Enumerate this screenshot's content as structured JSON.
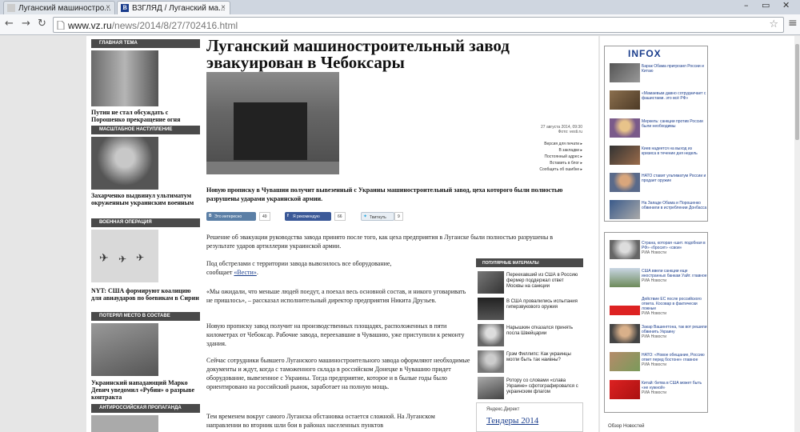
{
  "browser": {
    "tabs": [
      {
        "label": "Луганский машиностро...",
        "active": false
      },
      {
        "label": "ВЗГЛЯД / Луганский ма...",
        "active": true
      }
    ],
    "url_domain": "www.vz.ru",
    "url_path": "/news/2014/8/27/702416.html",
    "icons": [
      "back-icon",
      "forward-icon",
      "reload-icon",
      "star-icon",
      "menu-icon"
    ]
  },
  "sidebar": {
    "sections": [
      {
        "header": "ГЛАВНАЯ ТЕМА",
        "caption": "Путин не стал обсуждать с Порошенко прекращение огня"
      },
      {
        "header": "МАСШТАБНОЕ НАСТУПЛЕНИЕ",
        "caption": "Захарченко выдвинул ультиматум окруженным украинским военным"
      },
      {
        "header": "ВОЕННАЯ ОПЕРАЦИЯ",
        "caption": "NYT: США формируют коалицию для авиаударов по боевикам в Сирии"
      },
      {
        "header": "ПОТЕРЯЛ МЕСТО В СОСТАВЕ",
        "caption": "Украинский нападающий Марко Девич уведомил «Рубин» о разрыве контракта"
      },
      {
        "header": "АНТИРОССИЙСКАЯ ПРОПАГАНДА",
        "caption": ""
      }
    ]
  },
  "article": {
    "title": "Луганский машиностроительный завод эвакуирован в Чебоксары",
    "date": "27 августа 2014, 09:30",
    "source": "Фото: vesti.ru",
    "links": [
      "Версия для печати",
      "В закладки",
      "Постоянный адрес",
      "Вставить в блог",
      "Сообщить об ошибке"
    ],
    "lead": "Новую прописку в Чувашии получит вывезенный с Украины машиностроительный завод, цеха которого были полностью разрушены ударами украинской армии.",
    "share": {
      "vk_label": "Это интересно",
      "vk_count": "49",
      "fb_label": "Я рекомендую",
      "fb_count": "66",
      "tw_label": "Твитнуть",
      "tw_count": "9"
    },
    "p1": "Решение об эвакуации руководства завода принято после того, как цеха предприятия в Луганске были полностью разрушены в результате ударов артиллерии украинской армии.",
    "p2a": "Под обстрелами с территории завода вывозилось все оборудование,",
    "p2b": "сообщает",
    "p2link": "«Вести»",
    "p3": "«Мы ожидали, что меньше людей поедут, а поехал весь основной состав, и никого уговаривать не пришлось», – рассказал исполнительный директор предприятия Никита Друзьев.",
    "p4": "Новую прописку завод получит на производственных площадях, расположенных в пяти километрах от Чебоксар. Рабочие завода, переехавшие в Чувашию, уже приступили к ремонту здания.",
    "p5": "Сейчас сотрудники бывшего Луганского машиностроительного завода оформляют необходимые документы и ждут, когда с таможенного склада в российском Донецке в Чувашию придет оборудование, вывезенное с Украины. Тогда предприятие, которое и в былые годы было ориентировано на российский рынок, заработает на полную мощь.",
    "p6": "Тем временем вокруг самого Луганска обстановка остается сложной. На Луганском направлении во вторник шли бои в районах населенных пунктов"
  },
  "popular": {
    "header": "ПОПУЛЯРНЫЕ МАТЕРИАЛЫ",
    "items": [
      "Переехавший из США в Россию фермер поддержал ответ Москвы на санкции",
      "В США провалились испытания гиперзвукового оружия",
      "Нарышкин отказался принять посла Швейцарии",
      "Грэм Филлипс: Как украинцы могли быть так наивны?",
      "Ротору со словами «слава Украине» сфотографировался с украинским флагом"
    ],
    "yandex_label": "Яндекс.Директ",
    "yandex_text": "Тендеры 2014"
  },
  "infox": {
    "logo": "INFOX",
    "items": [
      {
        "text": "Барак Обама пригрозил России и Китаю",
        "src": ""
      },
      {
        "text": "«Мамаевым давно сотрудничает с фашистами. это всё РФ»",
        "src": ""
      },
      {
        "text": "Меркель: санкции против России были необходимы",
        "src": ""
      },
      {
        "text": "Киев надеется на выход из кризиса в течение дня недель",
        "src": ""
      },
      {
        "text": "НАТО ставит ультиматум России и продает оружие",
        "src": ""
      },
      {
        "text": "На Западе Обама и Порошенко обвинили в истреблении Донбасса",
        "src": ""
      }
    ]
  },
  "ria": {
    "items": [
      {
        "text": "Страна, которая «шит. подобная в РФ» «бросит» «свои»",
        "src": "РИА Новости"
      },
      {
        "text": "США ввели санкции еще иностранных банкам Уайт. главное",
        "src": "РИА Новости"
      },
      {
        "text": "Действие ЕС после российского ответа. Косовар в фактически ложные",
        "src": "РИА Новости"
      },
      {
        "text": "Закар Вашингтона, так вот решили обвинить Украину",
        "src": "РИА Новости"
      },
      {
        "text": "НАТО: «Новое обещание, Россию ответ перед бостоне» главное",
        "src": "РИА Новости"
      },
      {
        "text": "Китай: битва в США может быть «не нужной»",
        "src": "РИА Новости"
      }
    ],
    "footer": "Обзор Новостей"
  }
}
